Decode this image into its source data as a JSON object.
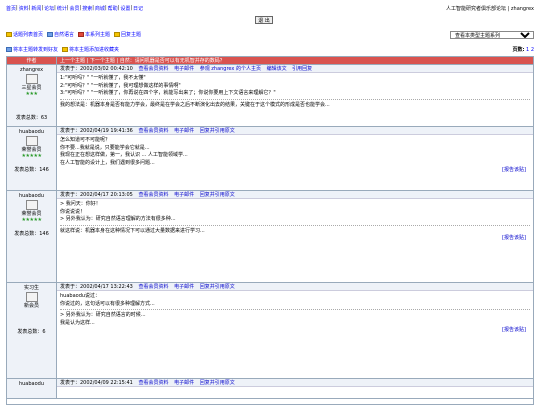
{
  "topbar": {
    "links": [
      "首页",
      "资料",
      "新闻",
      "论坛",
      "统计",
      "会员",
      "搜索",
      "商城",
      "帮助",
      "设置",
      "日记"
    ],
    "right": "人工智能研究者俱乐部论坛 | zhangrex",
    "logout": "退 出"
  },
  "nav": {
    "items": [
      "话题列表首页",
      "自然语言",
      "本系列主题",
      "回复主题"
    ],
    "select_value": "查看本类型主题系列"
  },
  "sub": {
    "items": [
      "将本主题转发到好友",
      "将本主题添加进收藏夹"
    ],
    "pages_label": "页数:",
    "pages": "1  2"
  },
  "header": {
    "col1": "作者",
    "col2": "上一个主题 | 下一个主题 | 自然：请问机器是否可以有无机智并存的数码？"
  },
  "posts": [
    {
      "author": "zhangrex",
      "rank": "三星会员",
      "stats": "发表总数：63",
      "date": "发表于：2002/03/02 00:42:10",
      "actions": [
        "查看会员资料",
        "电子邮件",
        "参观 zhangrex 的个人主页",
        "编辑该文",
        "引用回复"
      ],
      "lines": [
        "1:\"可听吗？\" \"一听就懂了，我不太懂\"",
        "2:\"可听吗？\" \"一听就懂了，我可理想做这样的事情啊\"",
        "3:\"可听吗？\" \"一听就懂了，你再说在四个字，就能写出来了；你说你要用上下文语言来理解它？\"",
        "我的想法是：机器本身是否有能力学会，最终是在学会之后不断演化出去的结果，关键在于这个模式的形成是否也能学会..."
      ]
    },
    {
      "author": "huabaodu",
      "rank": "荣誉会员",
      "stats": "发表总数：146",
      "date": "发表于：2002/04/19  19:41:36",
      "actions": [
        "查看会员资料",
        "电子邮件",
        "回复并引用原文"
      ],
      "lines": [
        "怎么知道可不可能呢？",
        "你不要...我就是说，只要能学会它就是...",
        "我现在正在想这样做，第一，我认识 ... 人工智能领域学...",
        "在人工智能的设计上，我们遇到很多问题..."
      ],
      "report": "[报告该贴]"
    },
    {
      "author": "huabaodu",
      "rank": "荣誉会员",
      "stats": "发表总数：146",
      "date": "发表于：2002/04/17  20:13:05",
      "actions": [
        "查看会员资料",
        "电子邮件",
        "回复并引用原文"
      ],
      "lines": [
        "> 我问天：你好！",
        "你说说说！",
        "> 另外我认为：研究自然语言理解的方法有很多种...",
        "就这样说：机器本身在这种情况下可以通过大量数据来进行学习..."
      ],
      "report": "[报告该贴]"
    },
    {
      "author": "实习生",
      "rank": "新会员",
      "stats": "发表总数：6",
      "date": "发表于：2002/04/17  13:22:43",
      "actions": [
        "查看会员资料",
        "电子邮件",
        "回复并引用原文"
      ],
      "lines": [
        "huabaodu说过：",
        "你说过的，这句话可以有很多种理解方式...",
        "> 另外我认为：研究自然语言的时候...",
        "我是认为这样..."
      ],
      "report": "[报告该贴]"
    },
    {
      "author": "huabaodu",
      "rank": "",
      "stats": "",
      "date": "发表于：2002/04/09  22:15:41",
      "actions": [
        "查看会员资料",
        "电子邮件",
        "回复并引用原文"
      ],
      "lines": []
    }
  ],
  "colors": {
    "header_bg": "#d9534f",
    "row_bg": "#eef2f8",
    "link": "#0000ff"
  }
}
